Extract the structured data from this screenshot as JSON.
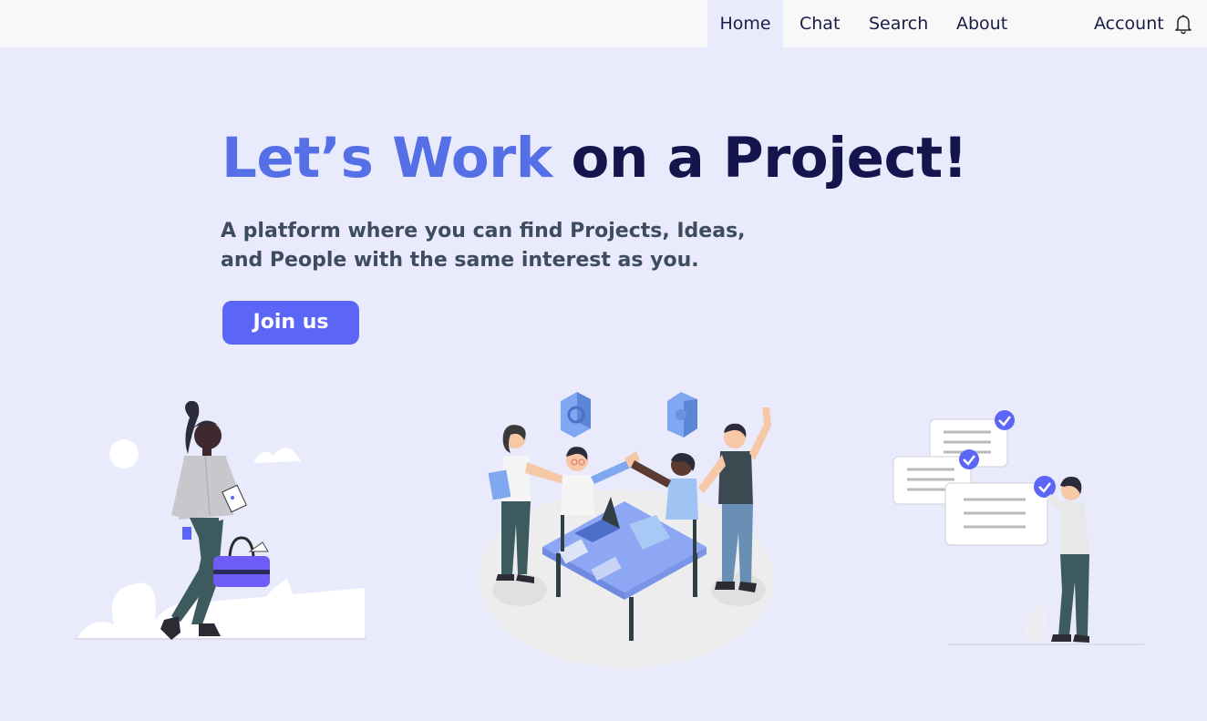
{
  "nav": {
    "items": [
      {
        "label": "Home",
        "active": true
      },
      {
        "label": "Chat",
        "active": false
      },
      {
        "label": "Search",
        "active": false
      },
      {
        "label": "About",
        "active": false
      }
    ],
    "account_label": "Account",
    "notification_icon": "bell-icon"
  },
  "hero": {
    "title_accent": "Let’s Work",
    "title_rest": "on a Project!",
    "subtitle": "A platform where you can find Projects, Ideas, and People with the same interest as you.",
    "cta_label": "Join us"
  },
  "illustrations": [
    {
      "name": "traveler-woman-illustration"
    },
    {
      "name": "team-collaboration-illustration"
    },
    {
      "name": "task-checklist-illustration"
    }
  ],
  "colors": {
    "background": "#EAEAFD",
    "accent": "#5570E6",
    "headline_dark": "#15154D",
    "button": "#5B66F6"
  }
}
